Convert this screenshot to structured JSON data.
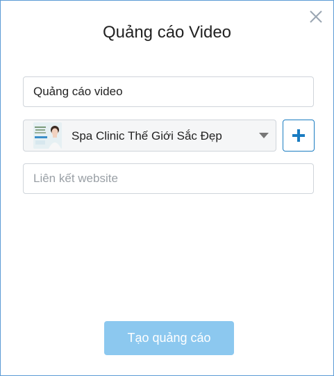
{
  "dialog": {
    "title": "Quảng cáo Video",
    "close_icon": "close-icon"
  },
  "form": {
    "ad_name": {
      "value": "Quảng cáo video",
      "placeholder": ""
    },
    "page_select": {
      "selected_label": "Spa Clinic Thế Giới Sắc Đẹp",
      "thumbnail": "page-thumbnail",
      "caret_icon": "chevron-down-icon"
    },
    "add_page_button": {
      "icon": "plus-icon",
      "color": "#1a7cc1"
    },
    "website_link": {
      "value": "",
      "placeholder": "Liên kết website"
    }
  },
  "actions": {
    "create_label": "Tạo quảng cáo",
    "create_color": "#8cc8ef"
  }
}
